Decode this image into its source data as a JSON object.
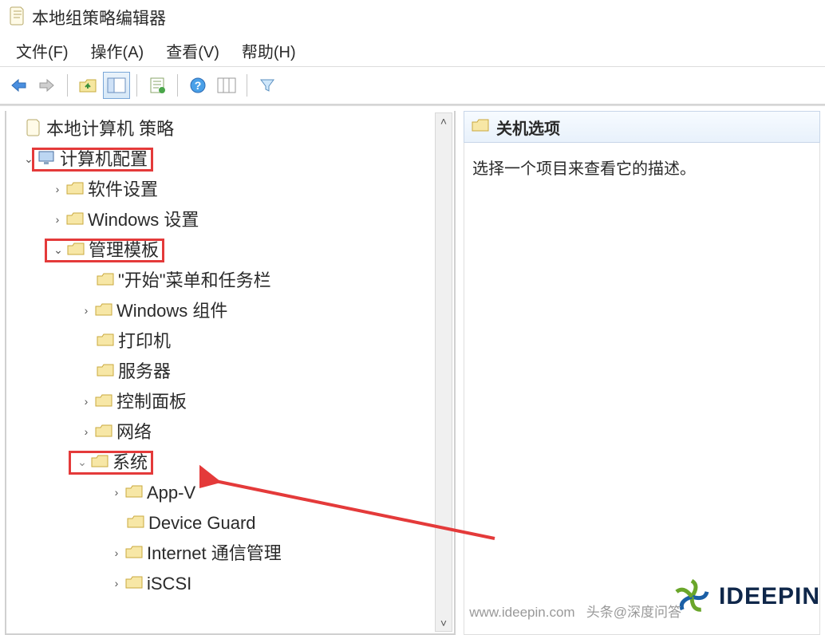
{
  "window": {
    "title": "本地组策略编辑器"
  },
  "menus": {
    "file": "文件(F)",
    "action": "操作(A)",
    "view": "查看(V)",
    "help": "帮助(H)"
  },
  "toolbar": {
    "back": "back-icon",
    "forward": "forward-icon",
    "up": "up-folder-icon",
    "show_hide": "show-hide-tree-icon",
    "properties": "properties-icon",
    "help": "help-icon",
    "layout": "layout-icon",
    "filter": "filter-icon"
  },
  "tree": {
    "root": {
      "label": "本地计算机 策略"
    },
    "computer_config": {
      "label": "计算机配置"
    },
    "software_settings": {
      "label": "软件设置"
    },
    "windows_settings": {
      "label": "Windows 设置"
    },
    "admin_templates": {
      "label": "管理模板"
    },
    "start_menu": {
      "label": "\"开始\"菜单和任务栏"
    },
    "windows_components": {
      "label": "Windows 组件"
    },
    "printers": {
      "label": "打印机"
    },
    "servers": {
      "label": "服务器"
    },
    "control_panel": {
      "label": "控制面板"
    },
    "network": {
      "label": "网络"
    },
    "system": {
      "label": "系统"
    },
    "appv": {
      "label": "App-V"
    },
    "device_guard": {
      "label": "Device Guard"
    },
    "internet_comm": {
      "label": "Internet 通信管理"
    },
    "iscsi": {
      "label": "iSCSI"
    }
  },
  "right": {
    "header": "关机选项",
    "placeholder": "选择一个项目来查看它的描述。"
  },
  "watermark": {
    "site": "www.ideepin.com",
    "brand": "IDEEPIN",
    "credit": "头条@深度问答"
  }
}
